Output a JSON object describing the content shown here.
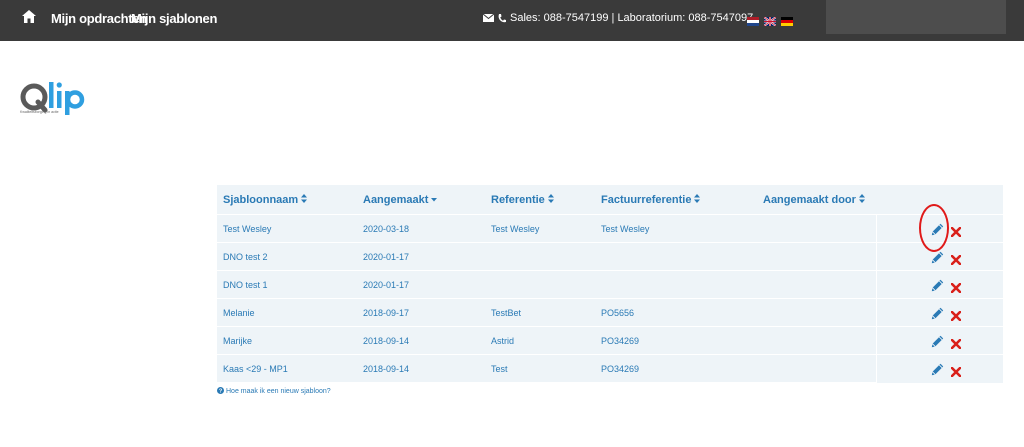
{
  "nav": {
    "home_icon": "home-icon",
    "opdrachten_label": "Mijn opdrachten",
    "sjablonen_label": "Mijn sjablonen"
  },
  "contact": {
    "text": "Sales: 088-7547199 | Laboratorium: 088-7547097"
  },
  "flags": [
    "nl-flag-icon",
    "uk-flag-icon",
    "de-flag-icon"
  ],
  "logo": {
    "text": "Qlip",
    "tagline": "Kwaliteitsborging in actie"
  },
  "table": {
    "headers": {
      "name": "Sjabloonnaam",
      "created": "Aangemaakt",
      "reference": "Referentie",
      "invoice_reference": "Factuurreferentie",
      "created_by": "Aangemaakt door"
    },
    "rows": [
      {
        "name": "Test Wesley",
        "created": "2020-03-18",
        "reference": "Test Wesley",
        "invoice_reference": "Test Wesley",
        "created_by": ""
      },
      {
        "name": "DNO test 2",
        "created": "2020-01-17",
        "reference": "",
        "invoice_reference": "",
        "created_by": ""
      },
      {
        "name": "DNO test 1",
        "created": "2020-01-17",
        "reference": "",
        "invoice_reference": "",
        "created_by": ""
      },
      {
        "name": "Melanie",
        "created": "2018-09-17",
        "reference": "TestBet",
        "invoice_reference": "PO5656",
        "created_by": ""
      },
      {
        "name": "Marijke",
        "created": "2018-09-14",
        "reference": "Astrid",
        "invoice_reference": "PO34269",
        "created_by": ""
      },
      {
        "name": "Kaas <29 - MP1",
        "created": "2018-09-14",
        "reference": "Test",
        "invoice_reference": "PO34269",
        "created_by": ""
      }
    ]
  },
  "help": {
    "text": "Hoe maak ik een nieuw sjabloon?"
  },
  "colors": {
    "topbar": "#3a3a3a",
    "link": "#2a7ab5",
    "delete": "#d9201a",
    "table_bg": "#eef4f8"
  }
}
